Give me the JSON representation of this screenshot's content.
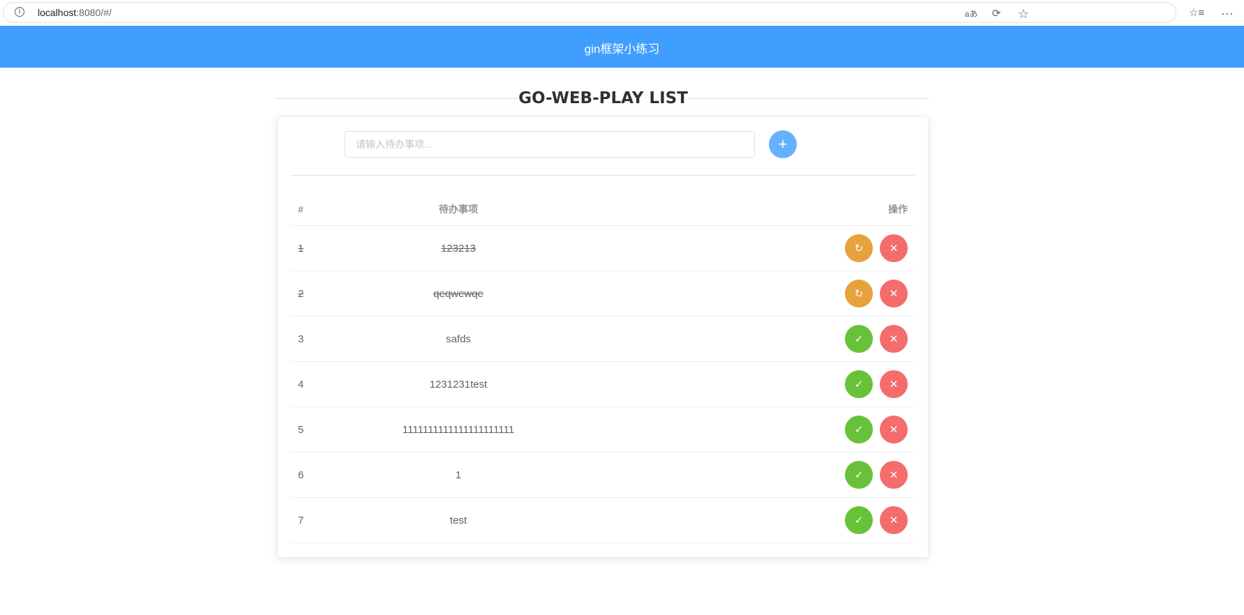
{
  "browser": {
    "url_host": "localhost",
    "url_rest": ":8080/#/",
    "icons": [
      "info-icon",
      "read-aloud-icon",
      "edge-sync-icon",
      "favorite-star-icon",
      "favorites-list-icon",
      "more-icon"
    ]
  },
  "header": {
    "title": "gin框架小练习"
  },
  "page": {
    "section_title": "GO-WEB-PLAY LIST"
  },
  "input": {
    "placeholder": "请输入待办事项...",
    "value": ""
  },
  "add_button": {
    "label": "+"
  },
  "table": {
    "headers": {
      "index": "#",
      "item": "待办事项",
      "actions": "操作"
    },
    "rows": [
      {
        "index": "1",
        "item": "123213",
        "done": true
      },
      {
        "index": "2",
        "item": "qeqwewqe",
        "done": true
      },
      {
        "index": "3",
        "item": "safds",
        "done": false
      },
      {
        "index": "4",
        "item": "1231231test",
        "done": false
      },
      {
        "index": "5",
        "item": "1111111111111111111111",
        "done": false
      },
      {
        "index": "6",
        "item": "1",
        "done": false
      },
      {
        "index": "7",
        "item": "test",
        "done": false
      }
    ]
  },
  "colors": {
    "header_bg": "#409eff",
    "add_button": "#66b1ff",
    "undo_button": "#e6a23c",
    "complete_button": "#67c23a",
    "delete_button": "#f56c6c"
  }
}
